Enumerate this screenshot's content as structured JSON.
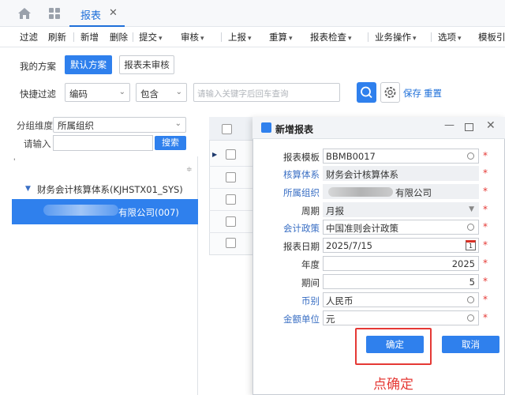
{
  "tabbar": {
    "tab_label": "报表",
    "close_glyph": "✕"
  },
  "toolbar": {
    "items": [
      {
        "label": "过滤"
      },
      {
        "label": "刷新"
      },
      {
        "label": "新增"
      },
      {
        "label": "删除"
      },
      {
        "label": "提交",
        "dropdown": true
      },
      {
        "label": "审核",
        "dropdown": true
      },
      {
        "label": "上报",
        "dropdown": true
      },
      {
        "label": "重算",
        "dropdown": true
      },
      {
        "label": "报表检查",
        "dropdown": true
      },
      {
        "label": "业务操作",
        "dropdown": true
      },
      {
        "label": "选项",
        "dropdown": true
      },
      {
        "label": "模板引"
      }
    ]
  },
  "scheme": {
    "label": "我的方案",
    "default_btn": "默认方案",
    "unreviewed_btn": "报表未审核"
  },
  "quick_filter": {
    "label": "快捷过滤",
    "field_value": "编码",
    "op_value": "包含",
    "search_placeholder": "请输入关键字后回车查询",
    "save_link": "保存",
    "reset_link": "重置"
  },
  "left_panel": {
    "group_label": "分组维度",
    "group_value": "所属组织",
    "input_label": "请输入",
    "search_btn": "搜索",
    "tree_root": "财务会计核算体系(KJHSTX01_SYS)",
    "tree_selected": "有限公司(007)"
  },
  "dialog": {
    "title": "新增报表",
    "fields": {
      "template": {
        "label": "报表模板",
        "value": "BBMB0017"
      },
      "acct_system": {
        "label": "核算体系",
        "value": "财务会计核算体系"
      },
      "org": {
        "label": "所属组织",
        "value": "有限公司"
      },
      "period_type": {
        "label": "周期",
        "value": "月报"
      },
      "policy": {
        "label": "会计政策",
        "value": "中国准则会计政策"
      },
      "report_date": {
        "label": "报表日期",
        "value": "2025/7/15"
      },
      "year": {
        "label": "年度",
        "value": "2025"
      },
      "period": {
        "label": "期间",
        "value": "5"
      },
      "currency": {
        "label": "币别",
        "value": "人民币"
      },
      "unit": {
        "label": "金额单位",
        "value": "元"
      }
    },
    "required_mark": "*",
    "confirm_btn": "确定",
    "cancel_btn": "取消",
    "calendar_day": "1"
  },
  "annotation": "点确定",
  "colors": {
    "accent": "#2f80ed",
    "highlight": "#e53935"
  }
}
